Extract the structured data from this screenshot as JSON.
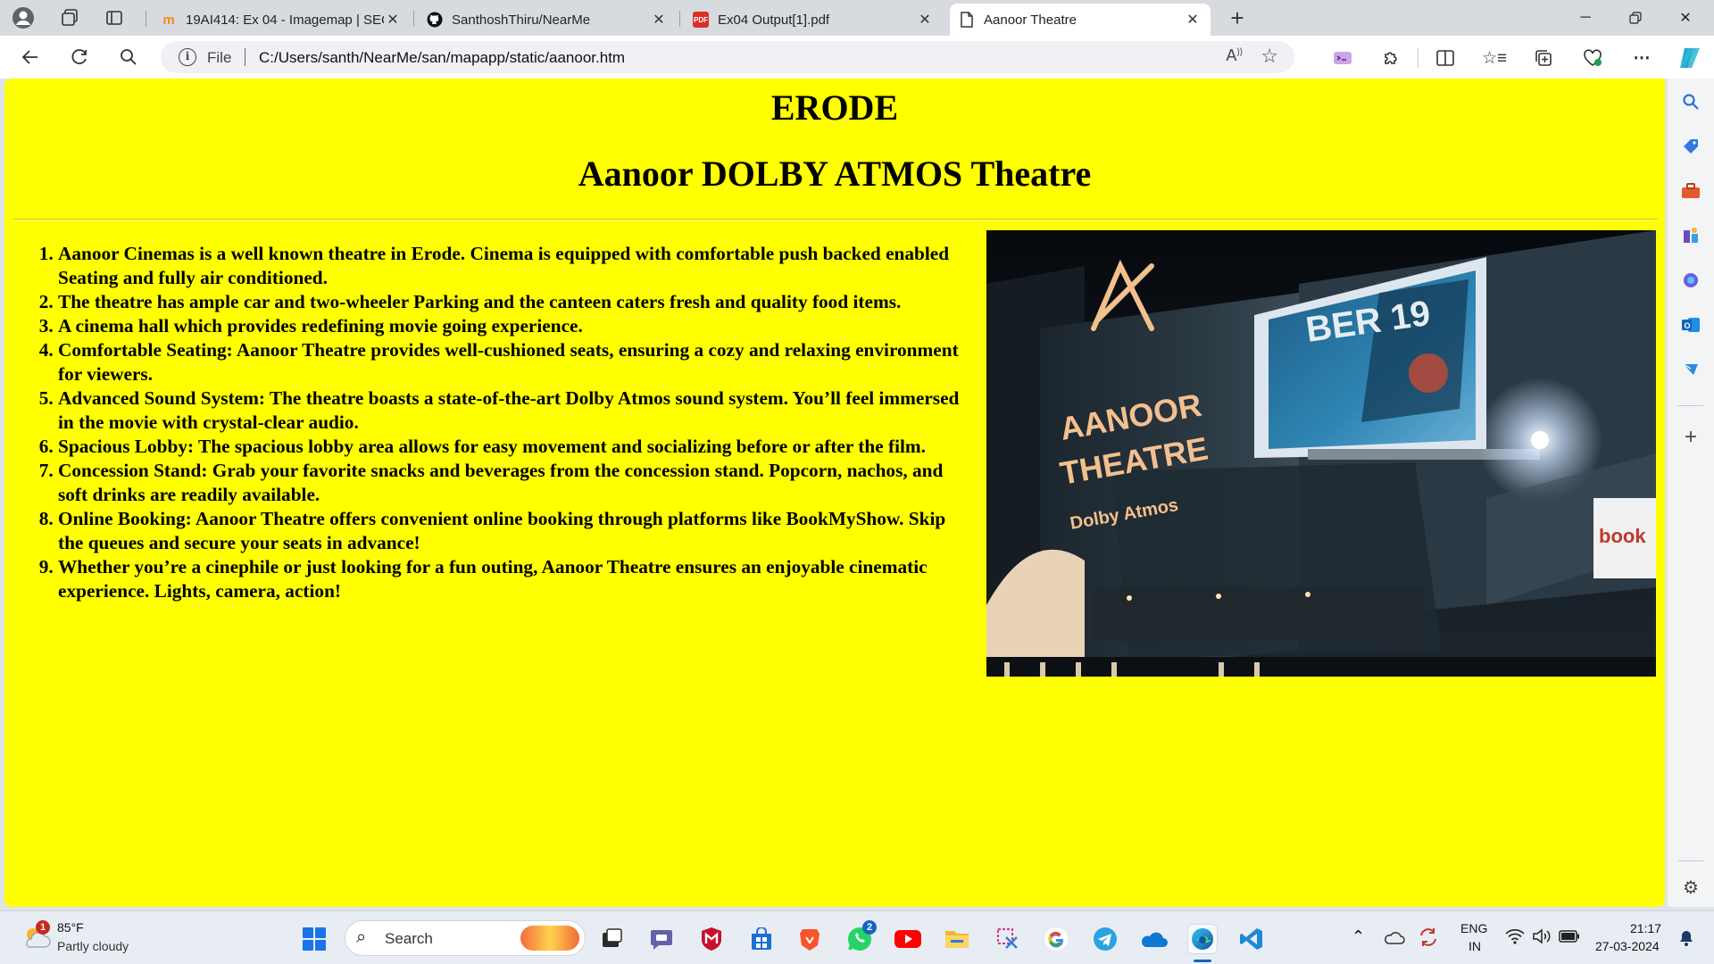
{
  "browser": {
    "tabs": [
      {
        "title": "19AI414: Ex 04 - Imagemap | SEC",
        "favicon": "moodle-icon",
        "active": false
      },
      {
        "title": "SanthoshThiru/NearMe",
        "favicon": "github-icon",
        "active": false
      },
      {
        "title": "Ex04 Output[1].pdf",
        "favicon": "pdf-icon",
        "active": false
      },
      {
        "title": "Aanoor Theatre",
        "favicon": "page-icon",
        "active": true
      }
    ],
    "address": {
      "scheme_label": "File",
      "url": "C:/Users/santh/NearMe/san/mapapp/static/aanoor.htm"
    }
  },
  "page": {
    "heading_city": "ERODE",
    "heading_theatre": "Aanoor DOLBY ATMOS Theatre",
    "background_color": "#ffff00",
    "items": [
      "Aanoor Cinemas is a well known theatre in Erode. Cinema is equipped with comfortable push backed enabled Seating and fully air conditioned.",
      "The theatre has ample car and two-wheeler Parking and the canteen caters fresh and quality food items.",
      "A cinema hall which provides redefining movie going experience.",
      "Comfortable Seating: Aanoor Theatre provides well-cushioned seats, ensuring a cozy and relaxing environment for viewers.",
      "Advanced Sound System: The theatre boasts a state-of-the-art Dolby Atmos sound system. You’ll feel immersed in the movie with crystal-clear audio.",
      "Spacious Lobby: The spacious lobby area allows for easy movement and socializing before or after the film.",
      "Concession Stand: Grab your favorite snacks and beverages from the concession stand. Popcorn, nachos, and soft drinks are readily available.",
      "Online Booking: Aanoor Theatre offers convenient online booking through platforms like BookMyShow. Skip the queues and secure your seats in advance!",
      "Whether you’re a cinephile or just looking for a fun outing, Aanoor Theatre ensures an enjoyable cinematic experience. Lights, camera, action!"
    ],
    "photo": {
      "sign_line1": "AANOOR",
      "sign_line2": "THEATRE",
      "sign_dolby": "Dolby Atmos",
      "poster_text": "BER 19",
      "board_text": "book"
    }
  },
  "taskbar": {
    "weather_temp": "85°F",
    "weather_desc": "Partly cloudy",
    "weather_badge": "1",
    "search_label": "Search",
    "whatsapp_badge": "2",
    "lang_line1": "ENG",
    "lang_line2": "IN",
    "time": "21:17",
    "date": "27-03-2024"
  }
}
